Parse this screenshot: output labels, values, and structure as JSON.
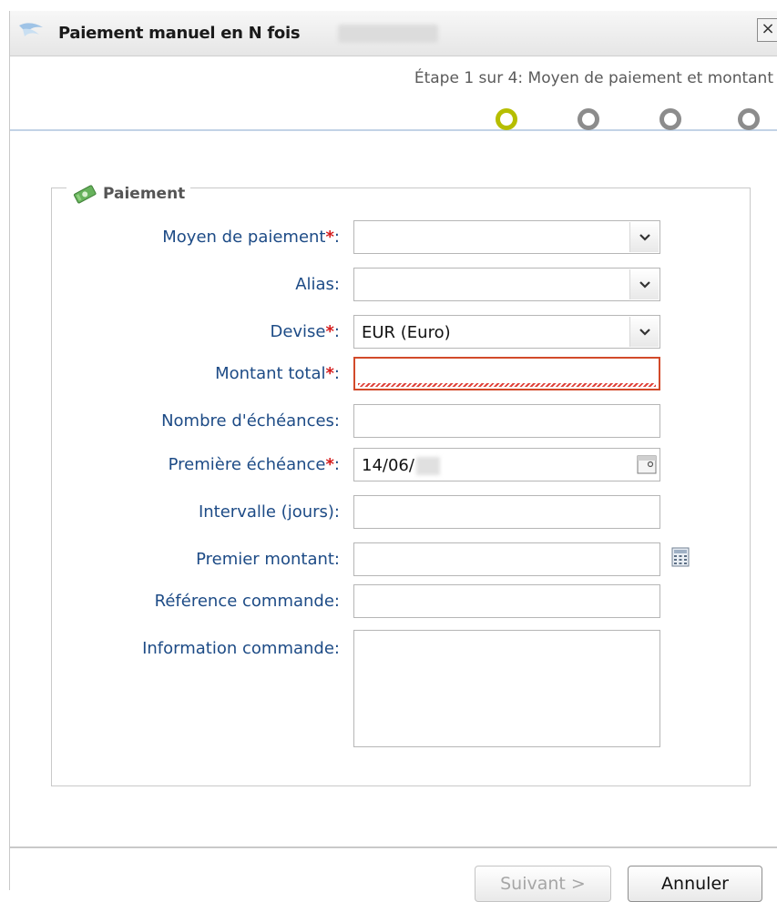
{
  "window": {
    "title": "Paiement manuel en N fois",
    "close_label": "×"
  },
  "steps": {
    "label": "Étape 1 sur 4: Moyen de paiement et montant",
    "count": 4,
    "current": 1
  },
  "fieldset": {
    "legend": "Paiement"
  },
  "form": {
    "payment_method": {
      "label": "Moyen de paiement",
      "required": "*",
      "suffix": ":",
      "value": ""
    },
    "alias": {
      "label": "Alias:",
      "value": ""
    },
    "currency": {
      "label": "Devise",
      "required": "*",
      "suffix": ":",
      "value": "EUR (Euro)"
    },
    "total_amount": {
      "label": "Montant total",
      "required": "*",
      "suffix": ":",
      "value": ""
    },
    "installments": {
      "label": "Nombre d'échéances:",
      "value": ""
    },
    "first_due": {
      "label": "Première échéance",
      "required": "*",
      "suffix": ":",
      "value": "14/06/"
    },
    "interval": {
      "label": "Intervalle (jours):",
      "value": ""
    },
    "first_amount": {
      "label": "Premier montant:",
      "value": ""
    },
    "order_ref": {
      "label": "Référence commande:",
      "value": ""
    },
    "order_info": {
      "label": "Information commande:",
      "value": ""
    }
  },
  "buttons": {
    "next": "Suivant >",
    "cancel": "Annuler"
  },
  "colors": {
    "label_blue": "#1d4b86",
    "required_red": "#d51c1c",
    "active_step": "#b6be00",
    "inactive_step": "#8c8c8c",
    "error_border": "#d24a2a"
  }
}
